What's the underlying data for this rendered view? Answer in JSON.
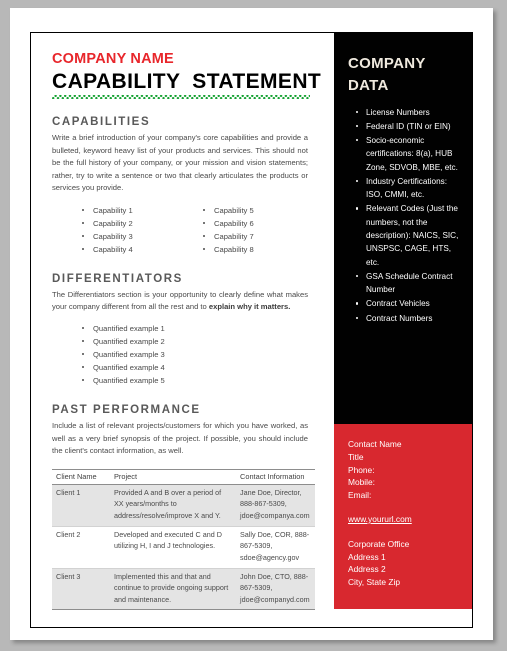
{
  "document": {
    "company_name": "COMPANY NAME",
    "title": "CAPABILITY  STATEMENT"
  },
  "capabilities": {
    "heading": "CAPABILITIES",
    "body": "Write a brief introduction of your company's core capabilities and provide a bulleted, keyword heavy list of your products and services. This should not be the full history of your company, or your mission and vision statements; rather, try to write a sentence or two that clearly articulates the products or services you provide.",
    "column_left": [
      "Capability 1",
      "Capability 2",
      "Capability 3",
      "Capability 4"
    ],
    "column_right": [
      "Capability 5",
      "Capability 6",
      "Capability 7",
      "Capability 8"
    ]
  },
  "differentiators": {
    "heading": "DIFFERENTIATORS",
    "body_lead": "The Differentiators section is your opportunity to clearly define what makes your company different from all the rest and to ",
    "body_bold": "explain why it matters.",
    "items": [
      "Quantified example 1",
      "Quantified example 2",
      "Quantified example 3",
      "Quantified example 4",
      "Quantified example 5"
    ]
  },
  "past_performance": {
    "heading": "PAST PERFORMANCE",
    "body": "Include a list of relevant projects/customers for which you have worked, as well as a very brief synopsis of the project. If possible, you should include the client's contact information, as well.",
    "table": {
      "headers": [
        "Client Name",
        "Project",
        "Contact Information"
      ],
      "rows": [
        {
          "client": "Client 1",
          "project": "Provided A and B over a period of XX years/months to address/resolve/improve X and Y.",
          "contact": "Jane Doe, Director, 888-867-5309, jdoe@companya.com"
        },
        {
          "client": "Client 2",
          "project": "Developed and executed C and D utilizing H, I and J technologies.",
          "contact": "Sally Doe, COR, 888-867-5309, sdoe@agency.gov"
        },
        {
          "client": "Client 3",
          "project": "Implemented this and that and continue to provide ongoing support and maintenance.",
          "contact": "John Doe, CTO, 888-867-5309, jdoe@companyd.com"
        }
      ]
    }
  },
  "company_data": {
    "heading": "COMPANY DATA",
    "items": [
      "License Numbers",
      "Federal ID (TIN or EIN)",
      "Socio-economic certifications: 8(a), HUB Zone, SDVOB, MBE, etc.",
      "Industry Certifications: ISO, CMMI, etc.",
      "Relevant Codes (Just the numbers, not the description): NAICS, SIC, UNSPSC, CAGE, HTS, etc.",
      "GSA Schedule Contract Number",
      "Contract Vehicles",
      "Contract Numbers"
    ]
  },
  "contact": {
    "lines": [
      "Contact Name",
      "Title",
      "Phone:",
      "Mobile:",
      "Email:"
    ],
    "url": "www.yoururl.com",
    "address": [
      "Corporate Office",
      "Address 1",
      "Address 2",
      "City, State Zip"
    ]
  },
  "colors": {
    "brand_red": "#d8282f",
    "header_red": "#e8262b",
    "panel_black": "#010101",
    "heading_gray": "#595959",
    "spellcheck_green": "#15a132"
  }
}
